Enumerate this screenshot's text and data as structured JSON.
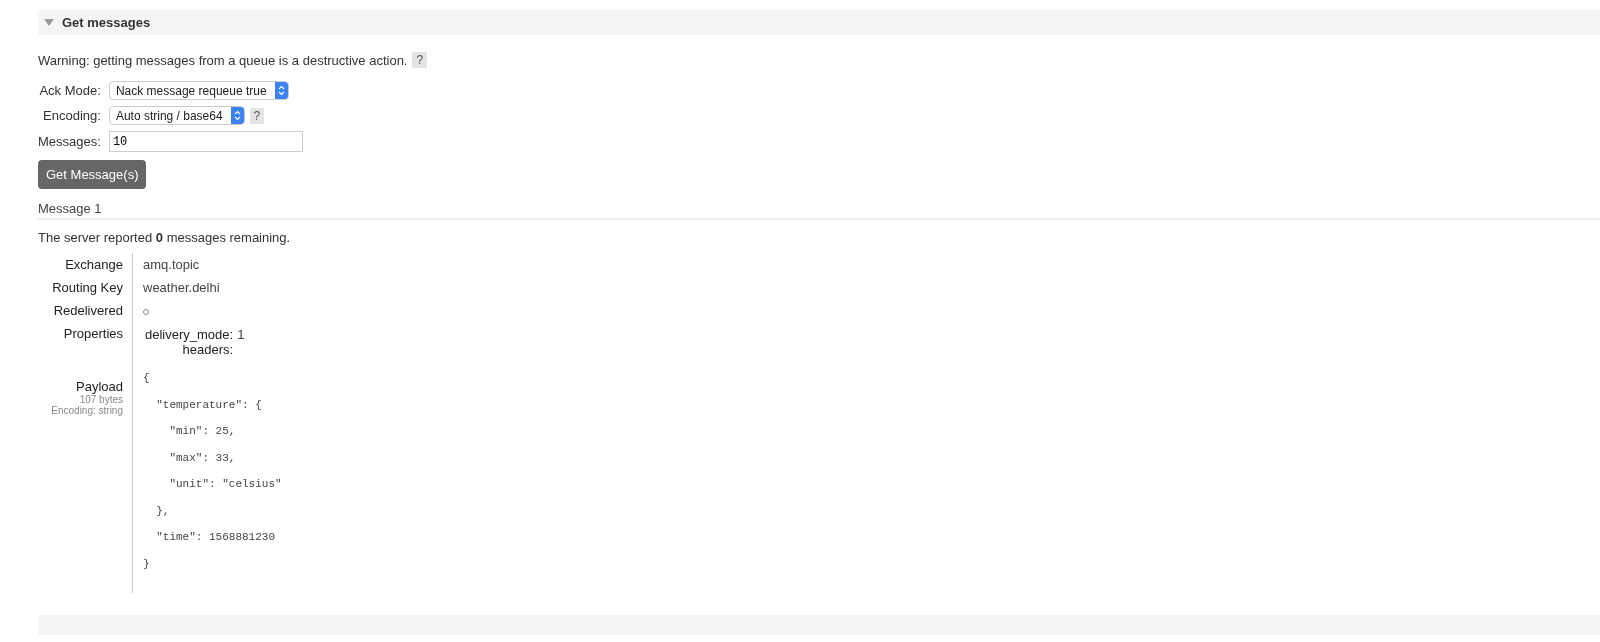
{
  "section": {
    "title": "Get messages",
    "expanded": true
  },
  "warning": {
    "text": "Warning: getting messages from a queue is a destructive action.",
    "help": "?"
  },
  "form": [
    {
      "kind": "select",
      "label": "Ack Mode:",
      "value": "Nack message requeue true"
    },
    {
      "kind": "select",
      "label": "Encoding:",
      "value": "Auto string / base64",
      "help": "?"
    },
    {
      "kind": "input",
      "label": "Messages:",
      "value": "10"
    }
  ],
  "button": "Get Message(s)",
  "message": {
    "title": "Message 1",
    "remaining": "The server reported **0** messages remaining.",
    "fields": [
      {
        "label": "Exchange",
        "value": "amq.topic"
      },
      {
        "label": "Routing Key",
        "value": "weather.delhi"
      },
      {
        "label": "Redelivered",
        "redelivered": false
      }
    ],
    "properties": {
      "label": "Properties",
      "items": [
        {
          "key": "delivery_mode:",
          "value": "1"
        },
        {
          "key": "headers:"
        }
      ]
    },
    "payload": {
      "label": "Payload",
      "size": "107 bytes",
      "encoding": "Encoding: string",
      "lines": [
        "{",
        "  \"temperature\": {",
        "    \"min\": 25,",
        "    \"max\": 33,",
        "    \"unit\": \"celsius\"",
        "  },",
        "  \"time\": 1568881230",
        "}"
      ]
    }
  }
}
